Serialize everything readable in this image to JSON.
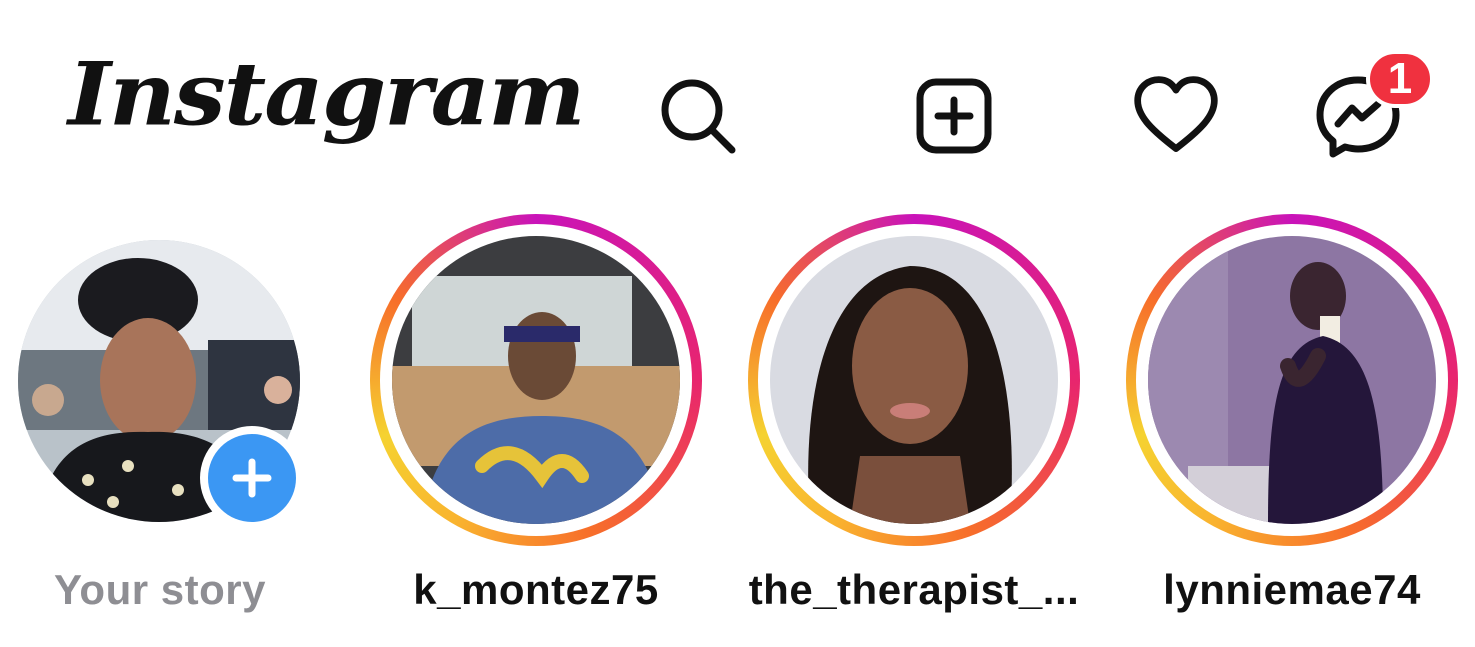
{
  "header": {
    "logo_text": "Instagram",
    "icons": [
      "search-icon",
      "new-post-icon",
      "heart-icon",
      "messenger-icon"
    ],
    "messenger_badge": "1",
    "badge_color": "#f0313f"
  },
  "stories": {
    "own": {
      "label": "Your story",
      "add_icon": "plus-icon",
      "add_color": "#3b97f3"
    },
    "items": [
      {
        "label": "k_montez75"
      },
      {
        "label": "the_therapist_..."
      },
      {
        "label": "lynniemae74"
      }
    ],
    "ring_colors": [
      "#c913b9",
      "#e8256e",
      "#f76e2a",
      "#f9b42f",
      "#f5d231"
    ]
  }
}
